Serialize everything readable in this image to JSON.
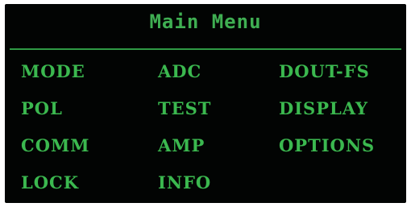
{
  "menu": {
    "title": "Main Menu",
    "items": [
      "MODE",
      "ADC",
      "DOUT-FS",
      "POL",
      "TEST",
      "DISPLAY",
      "COMM",
      "AMP",
      "OPTIONS",
      "LOCK",
      "INFO"
    ]
  },
  "colors": {
    "background": "#020403",
    "text": "#3bb84f",
    "divider": "#2f9a45"
  }
}
